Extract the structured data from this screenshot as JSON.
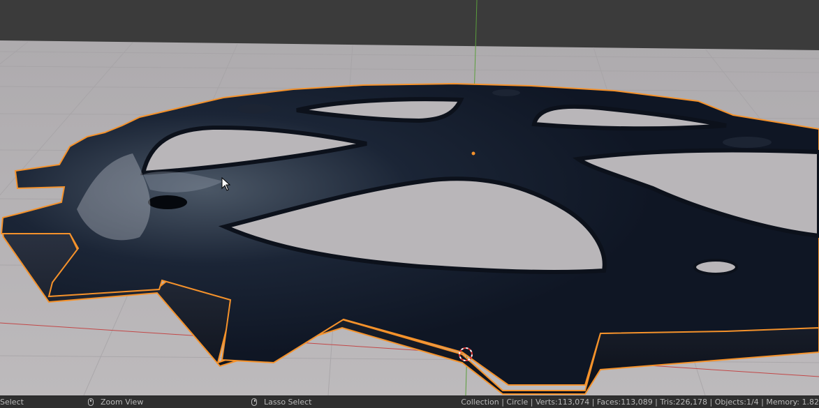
{
  "viewport": {
    "name": "3D Viewport",
    "colors": {
      "sky": "#3b3b3b",
      "floor": "#b7b4b7",
      "gear": "#121a28",
      "selection_outline": "#f5922b",
      "x_axis": "#c24747",
      "y_axis": "#5a9e3c"
    }
  },
  "statusbar": {
    "select_label": "Select",
    "zoom_label": "Zoom View",
    "lasso_label": "Lasso Select",
    "icons": [
      "mouse-left-icon",
      "mouse-middle-icon",
      "mouse-right-icon"
    ],
    "stats": "Collection | Circle | Verts:113,074 | Faces:113,089 | Tris:226,178 | Objects:1/4 | Memory: 1.82"
  }
}
